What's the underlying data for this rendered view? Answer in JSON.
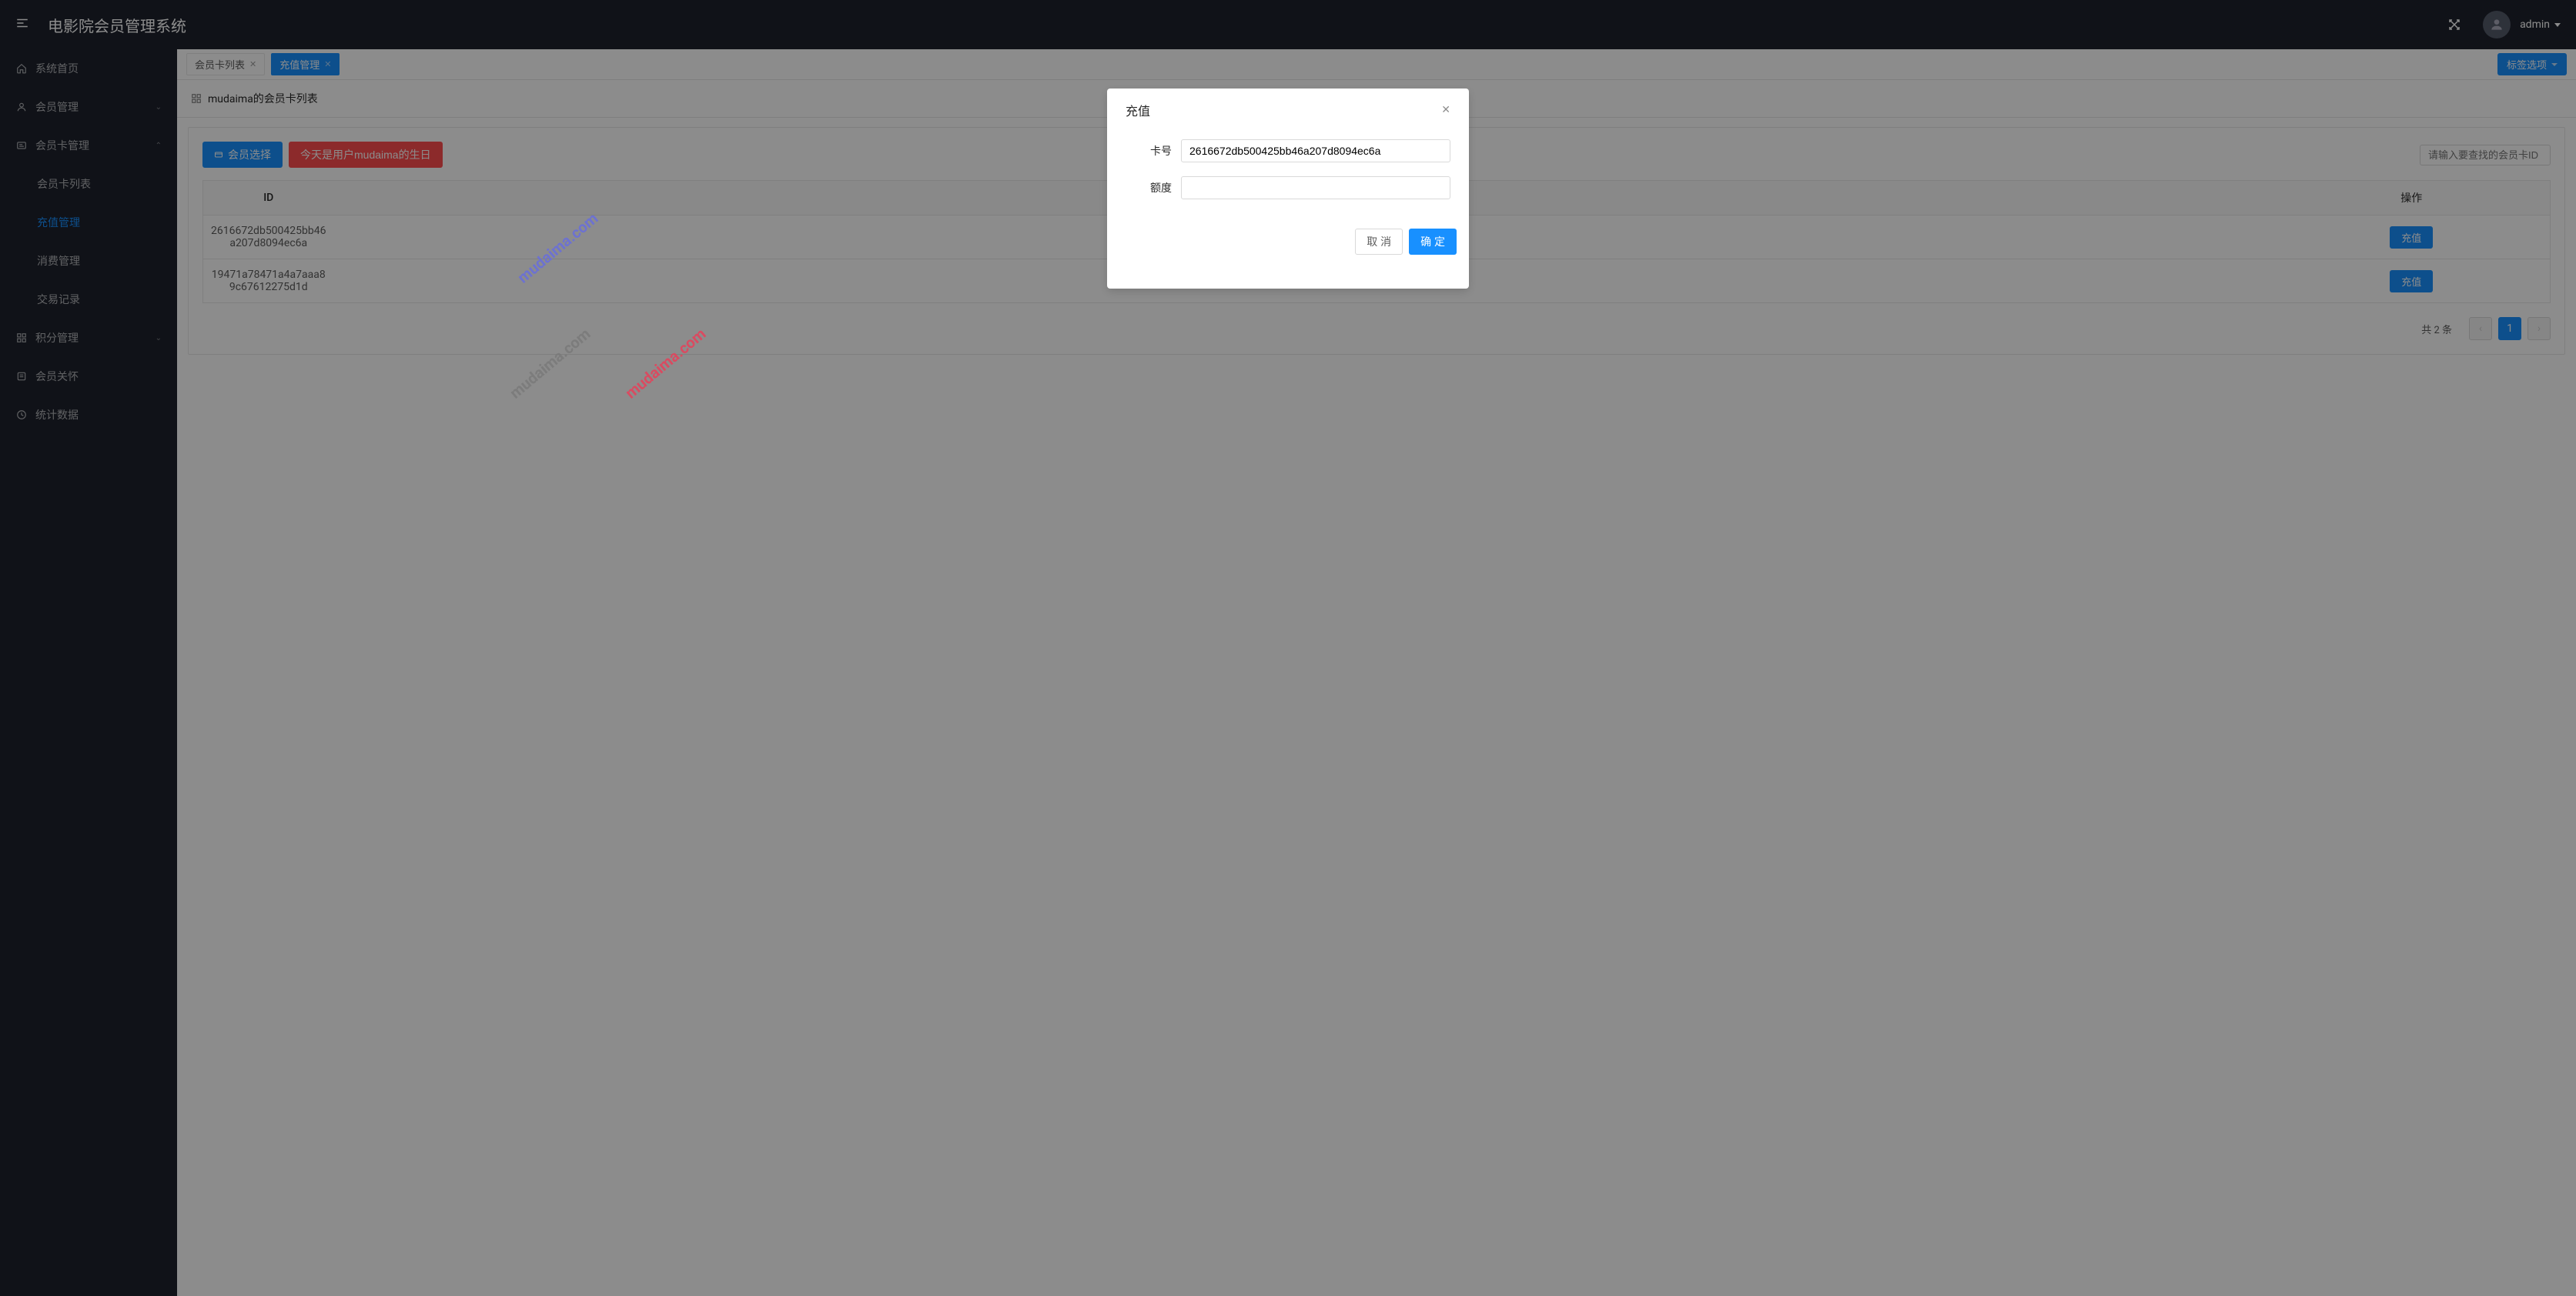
{
  "header": {
    "app_title": "电影院会员管理系统",
    "username": "admin"
  },
  "sidebar": {
    "items": [
      {
        "label": "系统首页",
        "icon": "home-icon",
        "expandable": false
      },
      {
        "label": "会员管理",
        "icon": "user-icon",
        "expandable": true,
        "open": false
      },
      {
        "label": "会员卡管理",
        "icon": "card-icon",
        "expandable": true,
        "open": true,
        "children": [
          {
            "label": "会员卡列表",
            "active": false
          },
          {
            "label": "充值管理",
            "active": true
          },
          {
            "label": "消费管理",
            "active": false
          },
          {
            "label": "交易记录",
            "active": false
          }
        ]
      },
      {
        "label": "积分管理",
        "icon": "grid-icon",
        "expandable": true,
        "open": false
      },
      {
        "label": "会员关怀",
        "icon": "list-icon",
        "expandable": false
      },
      {
        "label": "统计数据",
        "icon": "clock-icon",
        "expandable": false
      }
    ]
  },
  "tabs": {
    "items": [
      {
        "label": "会员卡列表",
        "active": false
      },
      {
        "label": "充值管理",
        "active": true
      }
    ],
    "options_label": "标签选项"
  },
  "content": {
    "page_title": "mudaima的会员卡列表",
    "toolbar": {
      "select_member_label": "会员选择",
      "birthday_notice": "今天是用户mudaima的生日",
      "search_placeholder": "请输入要查找的会员卡ID"
    },
    "table": {
      "columns": [
        "ID",
        "",
        "操作"
      ],
      "action_label": "充值",
      "rows": [
        {
          "id": "2616672db500425bb46a207d8094ec6a"
        },
        {
          "id": "19471a78471a4a7aaa89c67612275d1d"
        }
      ]
    },
    "pagination": {
      "total_text": "共 2 条",
      "current": "1"
    }
  },
  "modal": {
    "title": "充值",
    "fields": {
      "card_no_label": "卡号",
      "card_no_value": "2616672db500425bb46a207d8094ec6a",
      "amount_label": "额度",
      "amount_value": ""
    },
    "cancel_label": "取 消",
    "ok_label": "确 定"
  },
  "watermarks": [
    "mudaima.com",
    "mudaima.com",
    "mudaima.com"
  ]
}
